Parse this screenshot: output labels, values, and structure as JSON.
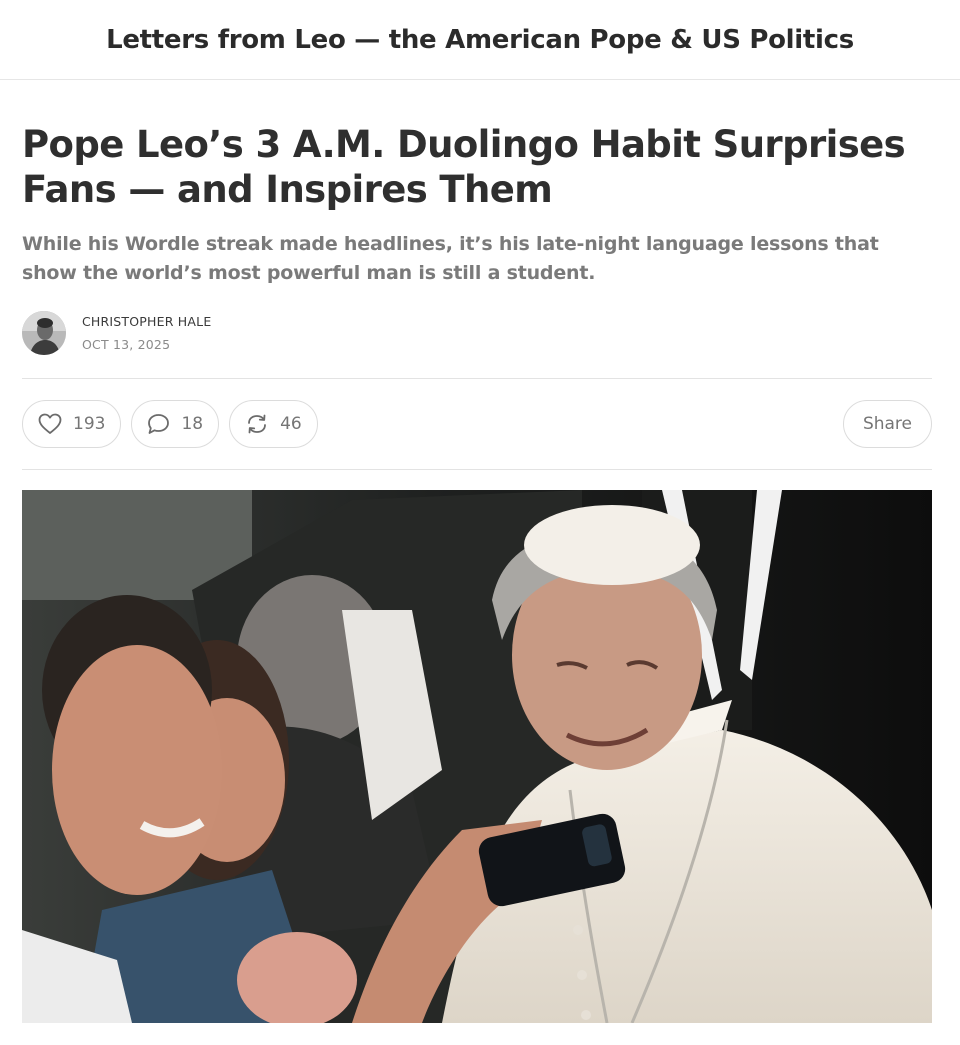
{
  "publication": {
    "name": "Letters from Leo — the American Pope & US Politics"
  },
  "post": {
    "title": "Pope Leo’s 3 A.M. Duolingo Habit Surprises Fans — and Inspires Them",
    "subtitle": "While his Wordle streak made headlines, it’s his late-night language lessons that show the world’s most powerful man is still a student.",
    "author": "CHRISTOPHER HALE",
    "date": "OCT 13, 2025"
  },
  "actions": {
    "like_count": "193",
    "comment_count": "18",
    "restack_count": "46",
    "share_label": "Share",
    "icons": {
      "like": "heart-icon",
      "comment": "comment-bubble-icon",
      "restack": "restack-arrows-icon"
    }
  },
  "colors": {
    "text_primary": "#2f2f2f",
    "text_secondary": "#7a7a7a",
    "border": "#dcdcdc"
  }
}
